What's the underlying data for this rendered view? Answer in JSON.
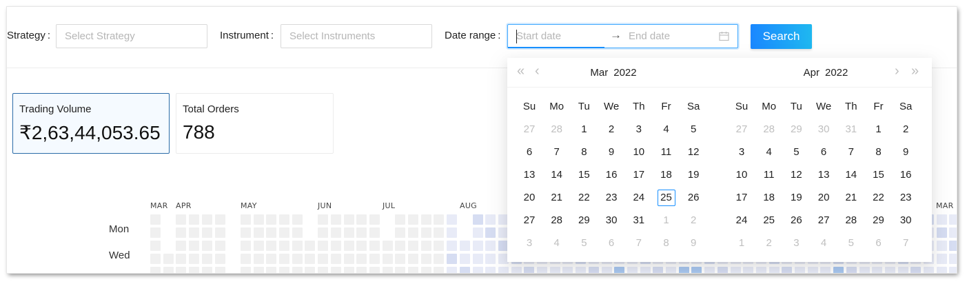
{
  "filters": {
    "strategy_label": "Strategy",
    "strategy_placeholder": "Select Strategy",
    "instrument_label": "Instrument",
    "instrument_placeholder": "Select Instruments",
    "date_range_label": "Date range",
    "start_placeholder": "Start date",
    "end_placeholder": "End date",
    "search_label": "Search"
  },
  "stats": [
    {
      "label": "Trading Volume",
      "value": "₹2,63,44,053.65",
      "active": true
    },
    {
      "label": "Total Orders",
      "value": "788",
      "active": false
    }
  ],
  "heatmap": {
    "months": [
      "MAR",
      "APR",
      "MAY",
      "JUN",
      "JUL",
      "AUG",
      "MAR"
    ],
    "day_labels": [
      "Mon",
      "Wed"
    ]
  },
  "calendar": {
    "weekdays": [
      "Su",
      "Mo",
      "Tu",
      "We",
      "Th",
      "Fr",
      "Sa"
    ],
    "today": 25,
    "left": {
      "month": "Mar",
      "year": "2022",
      "weeks": [
        [
          {
            "d": "27",
            "o": true
          },
          {
            "d": "28",
            "o": true
          },
          {
            "d": "1"
          },
          {
            "d": "2"
          },
          {
            "d": "3"
          },
          {
            "d": "4"
          },
          {
            "d": "5"
          }
        ],
        [
          {
            "d": "6"
          },
          {
            "d": "7"
          },
          {
            "d": "8"
          },
          {
            "d": "9"
          },
          {
            "d": "10"
          },
          {
            "d": "11"
          },
          {
            "d": "12"
          }
        ],
        [
          {
            "d": "13"
          },
          {
            "d": "14"
          },
          {
            "d": "15"
          },
          {
            "d": "16"
          },
          {
            "d": "17"
          },
          {
            "d": "18"
          },
          {
            "d": "19"
          }
        ],
        [
          {
            "d": "20"
          },
          {
            "d": "21"
          },
          {
            "d": "22"
          },
          {
            "d": "23"
          },
          {
            "d": "24"
          },
          {
            "d": "25",
            "t": true
          },
          {
            "d": "26"
          }
        ],
        [
          {
            "d": "27"
          },
          {
            "d": "28"
          },
          {
            "d": "29"
          },
          {
            "d": "30"
          },
          {
            "d": "31"
          },
          {
            "d": "1",
            "o": true
          },
          {
            "d": "2",
            "o": true
          }
        ],
        [
          {
            "d": "3",
            "o": true
          },
          {
            "d": "4",
            "o": true
          },
          {
            "d": "5",
            "o": true
          },
          {
            "d": "6",
            "o": true
          },
          {
            "d": "7",
            "o": true
          },
          {
            "d": "8",
            "o": true
          },
          {
            "d": "9",
            "o": true
          }
        ]
      ]
    },
    "right": {
      "month": "Apr",
      "year": "2022",
      "weeks": [
        [
          {
            "d": "27",
            "o": true
          },
          {
            "d": "28",
            "o": true
          },
          {
            "d": "29",
            "o": true
          },
          {
            "d": "30",
            "o": true
          },
          {
            "d": "31",
            "o": true
          },
          {
            "d": "1"
          },
          {
            "d": "2"
          }
        ],
        [
          {
            "d": "3"
          },
          {
            "d": "4"
          },
          {
            "d": "5"
          },
          {
            "d": "6"
          },
          {
            "d": "7"
          },
          {
            "d": "8"
          },
          {
            "d": "9"
          }
        ],
        [
          {
            "d": "10"
          },
          {
            "d": "11"
          },
          {
            "d": "12"
          },
          {
            "d": "13"
          },
          {
            "d": "14"
          },
          {
            "d": "15"
          },
          {
            "d": "16"
          }
        ],
        [
          {
            "d": "17"
          },
          {
            "d": "18"
          },
          {
            "d": "19"
          },
          {
            "d": "20"
          },
          {
            "d": "21"
          },
          {
            "d": "22"
          },
          {
            "d": "23"
          }
        ],
        [
          {
            "d": "24"
          },
          {
            "d": "25"
          },
          {
            "d": "26"
          },
          {
            "d": "27"
          },
          {
            "d": "28"
          },
          {
            "d": "29"
          },
          {
            "d": "30"
          }
        ],
        [
          {
            "d": "1",
            "o": true
          },
          {
            "d": "2",
            "o": true
          },
          {
            "d": "3",
            "o": true
          },
          {
            "d": "4",
            "o": true
          },
          {
            "d": "5",
            "o": true
          },
          {
            "d": "6",
            "o": true
          },
          {
            "d": "7",
            "o": true
          }
        ]
      ]
    },
    "nav_icons": [
      "double-left-icon",
      "left-icon",
      "right-icon",
      "double-right-icon"
    ]
  },
  "colors": {
    "accent": "#1890ff",
    "heat_empty": "#f0f0f0",
    "heat_light": "#e8ebf7",
    "heat_mid": "#d6ddf2",
    "heat_high": "#a9c8f0"
  }
}
